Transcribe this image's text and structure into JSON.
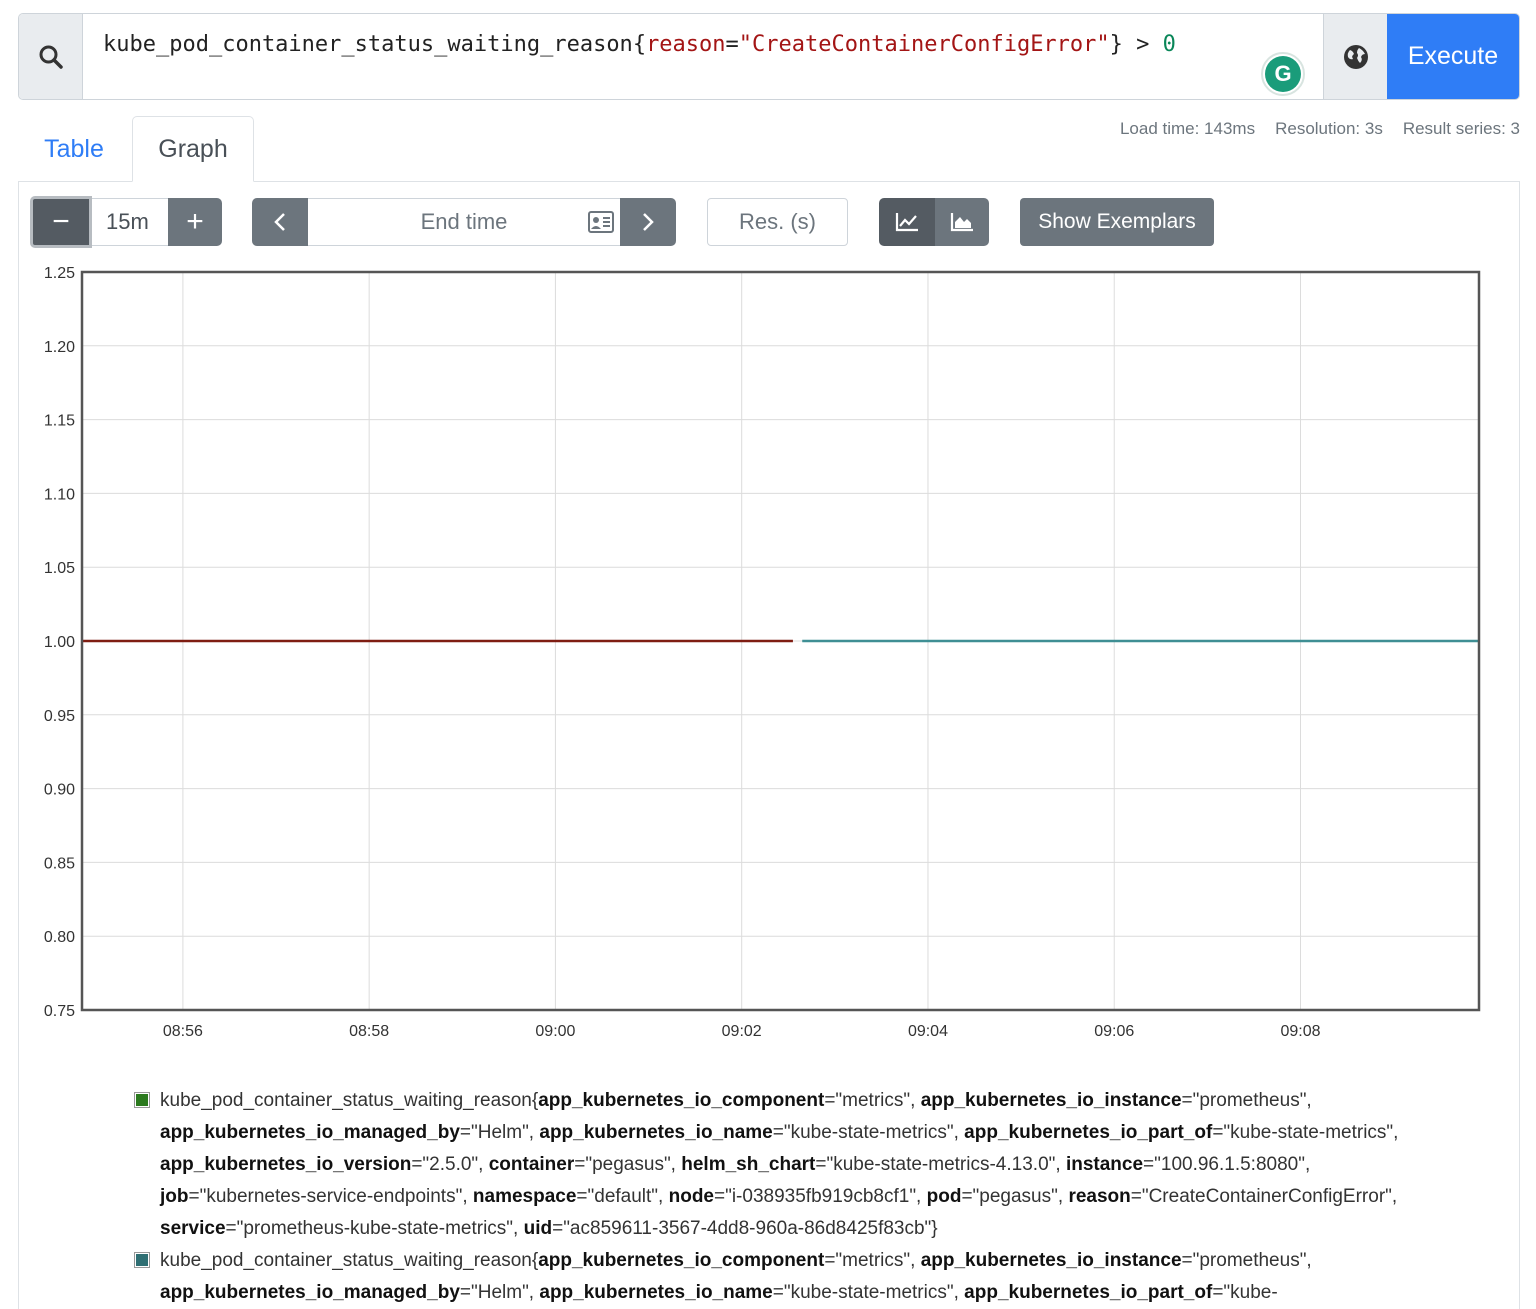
{
  "query": {
    "metric": "kube_pod_container_status_waiting_reason",
    "open": "{",
    "label": "reason",
    "eq": "=",
    "value": "\"CreateContainerConfigError\"",
    "close": "}",
    "op": " > ",
    "num": "0",
    "execute_label": "Execute"
  },
  "tabs": {
    "table": "Table",
    "graph": "Graph"
  },
  "stats": {
    "load_time": "Load time: 143ms",
    "resolution": "Resolution: 3s",
    "result_series": "Result series: 3"
  },
  "controls": {
    "minus": "−",
    "range": "15m",
    "plus": "+",
    "prev": "‹",
    "end_placeholder": "End time",
    "next": "›",
    "res_placeholder": "Res. (s)",
    "exemplars": "Show Exemplars",
    "icons": [
      "search-icon",
      "globe-icon",
      "calendar-icon",
      "line-chart-icon",
      "area-chart-icon"
    ]
  },
  "chart_data": {
    "type": "line",
    "ylim": [
      0.75,
      1.25
    ],
    "yticks": [
      "0.75",
      "0.80",
      "0.85",
      "0.90",
      "0.95",
      "1.00",
      "1.05",
      "1.10",
      "1.15",
      "1.20",
      "1.25"
    ],
    "xticks": [
      "08:56",
      "08:58",
      "09:00",
      "09:02",
      "09:04",
      "09:06",
      "09:08"
    ],
    "xlim": [
      "08:54:55",
      "09:09:55"
    ],
    "grid": true,
    "series": [
      {
        "color": "#7f1d12",
        "x": [
          "08:54:55",
          "09:02:33"
        ],
        "y": [
          1,
          1
        ]
      },
      {
        "color": "#3f8f94",
        "x": [
          "09:02:39",
          "09:09:55"
        ],
        "y": [
          1,
          1
        ]
      }
    ]
  },
  "legend": [
    {
      "color": "#2b7a1e",
      "metric": "kube_pod_container_status_waiting_reason",
      "labels": [
        {
          "k": "app_kubernetes_io_component",
          "v": "\"metrics\""
        },
        {
          "k": "app_kubernetes_io_instance",
          "v": "\"prometheus\""
        },
        {
          "k": "app_kubernetes_io_managed_by",
          "v": "\"Helm\""
        },
        {
          "k": "app_kubernetes_io_name",
          "v": "\"kube-state-metrics\""
        },
        {
          "k": "app_kubernetes_io_part_of",
          "v": "\"kube-state-metrics\""
        },
        {
          "k": "app_kubernetes_io_version",
          "v": "\"2.5.0\""
        },
        {
          "k": "container",
          "v": "\"pegasus\""
        },
        {
          "k": "helm_sh_chart",
          "v": "\"kube-state-metrics-4.13.0\""
        },
        {
          "k": "instance",
          "v": "\"100.96.1.5:8080\""
        },
        {
          "k": "job",
          "v": "\"kubernetes-service-endpoints\""
        },
        {
          "k": "namespace",
          "v": "\"default\""
        },
        {
          "k": "node",
          "v": "\"i-038935fb919cb8cf1\""
        },
        {
          "k": "pod",
          "v": "\"pegasus\""
        },
        {
          "k": "reason",
          "v": "\"CreateContainerConfigError\""
        },
        {
          "k": "service",
          "v": "\"prometheus-kube-state-metrics\""
        },
        {
          "k": "uid",
          "v": "\"ac859611-3567-4dd8-960a-86d8425f83cb\""
        }
      ]
    },
    {
      "color": "#2f6f73",
      "metric": "kube_pod_container_status_waiting_reason",
      "labels": [
        {
          "k": "app_kubernetes_io_component",
          "v": "\"metrics\""
        },
        {
          "k": "app_kubernetes_io_instance",
          "v": "\"prometheus\""
        },
        {
          "k": "app_kubernetes_io_managed_by",
          "v": "\"Helm\""
        },
        {
          "k": "app_kubernetes_io_name",
          "v": "\"kube-state-metrics\""
        },
        {
          "k": "app_kubernetes_io_part_of",
          "v": "\"kube-"
        }
      ]
    }
  ]
}
